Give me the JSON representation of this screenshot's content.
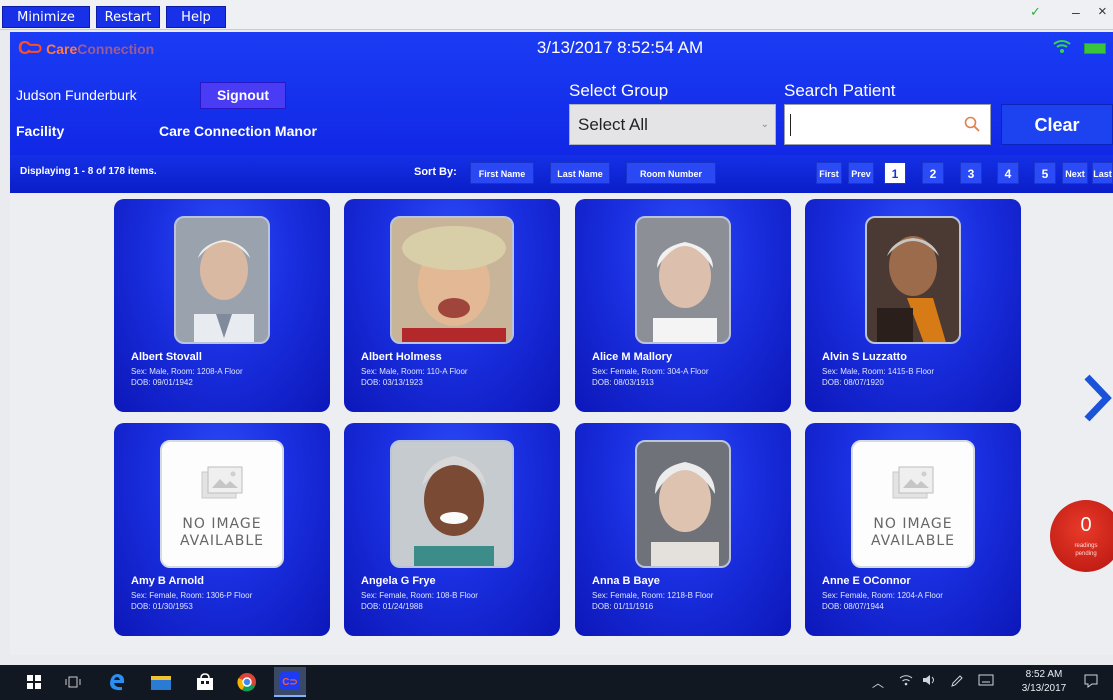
{
  "menubar": {
    "buttons": [
      "Minimize",
      "Restart",
      "Help"
    ],
    "window_controls": {
      "minimize": "–",
      "close": "×"
    }
  },
  "header": {
    "logo_mark": "C⊃",
    "logo_care": "Care",
    "logo_connection": "Connection",
    "datetime": "3/13/2017 8:52:54 AM",
    "user_name": "Judson Funderburk",
    "signout_label": "Signout",
    "facility_label": "Facility",
    "facility_name": "Care Connection Manor",
    "select_group_label": "Select Group",
    "select_group_value": "Select All",
    "search_label": "Search Patient",
    "search_value": "",
    "clear_label": "Clear"
  },
  "sortbar": {
    "display_count": "Displaying 1 - 8 of 178 items.",
    "sort_label": "Sort By:",
    "sort_buttons": [
      "First Name",
      "Last Name",
      "Room Number"
    ],
    "paging": {
      "first": "First",
      "prev": "Prev",
      "pages": [
        "1",
        "2",
        "3",
        "4",
        "5"
      ],
      "current_page": "1",
      "next": "Next",
      "last": "Last"
    }
  },
  "patients": [
    {
      "name": "Albert  Stovall",
      "line1": "Sex: Male, Room: 1208-A Floor",
      "line2": "DOB: 09/01/1942",
      "has_image": true
    },
    {
      "name": "Albert  Holmess",
      "line1": "Sex: Male, Room: 110-A Floor",
      "line2": "DOB: 03/13/1923",
      "has_image": true
    },
    {
      "name": "Alice M Mallory",
      "line1": "Sex: Female, Room: 304-A Floor",
      "line2": "DOB: 08/03/1913",
      "has_image": true
    },
    {
      "name": "Alvin S Luzzatto",
      "line1": "Sex: Male, Room: 1415-B Floor",
      "line2": "DOB: 08/07/1920",
      "has_image": true
    },
    {
      "name": "Amy B Arnold",
      "line1": "Sex: Female, Room: 1306-P Floor",
      "line2": "DOB: 01/30/1953",
      "has_image": false
    },
    {
      "name": "Angela G Frye",
      "line1": "Sex: Female, Room: 108-B Floor",
      "line2": "DOB: 01/24/1988",
      "has_image": true
    },
    {
      "name": "Anna B Baye",
      "line1": "Sex: Female, Room: 1218-B Floor",
      "line2": "DOB: 01/11/1916",
      "has_image": true
    },
    {
      "name": "Anne E OConnor",
      "line1": "Sex: Female, Room: 1204-A Floor",
      "line2": "DOB: 08/07/1944",
      "has_image": false
    }
  ],
  "no_image_text": "NO IMAGE AVAILABLE",
  "pending": {
    "count": "0",
    "label": "readings pending"
  },
  "taskbar": {
    "time": "8:52 AM",
    "date": "3/13/2017",
    "icons": [
      "windows-start-icon",
      "task-view-icon",
      "edge-icon",
      "file-explorer-icon",
      "store-icon",
      "chrome-icon",
      "careconnection-app-icon"
    ]
  },
  "colors": {
    "brand_blue": "#1b3cf4",
    "card_blue": "#1a2fe0",
    "logo_orange": "#ff5a2d",
    "pending_red": "#d22518",
    "taskbar": "#111821"
  }
}
